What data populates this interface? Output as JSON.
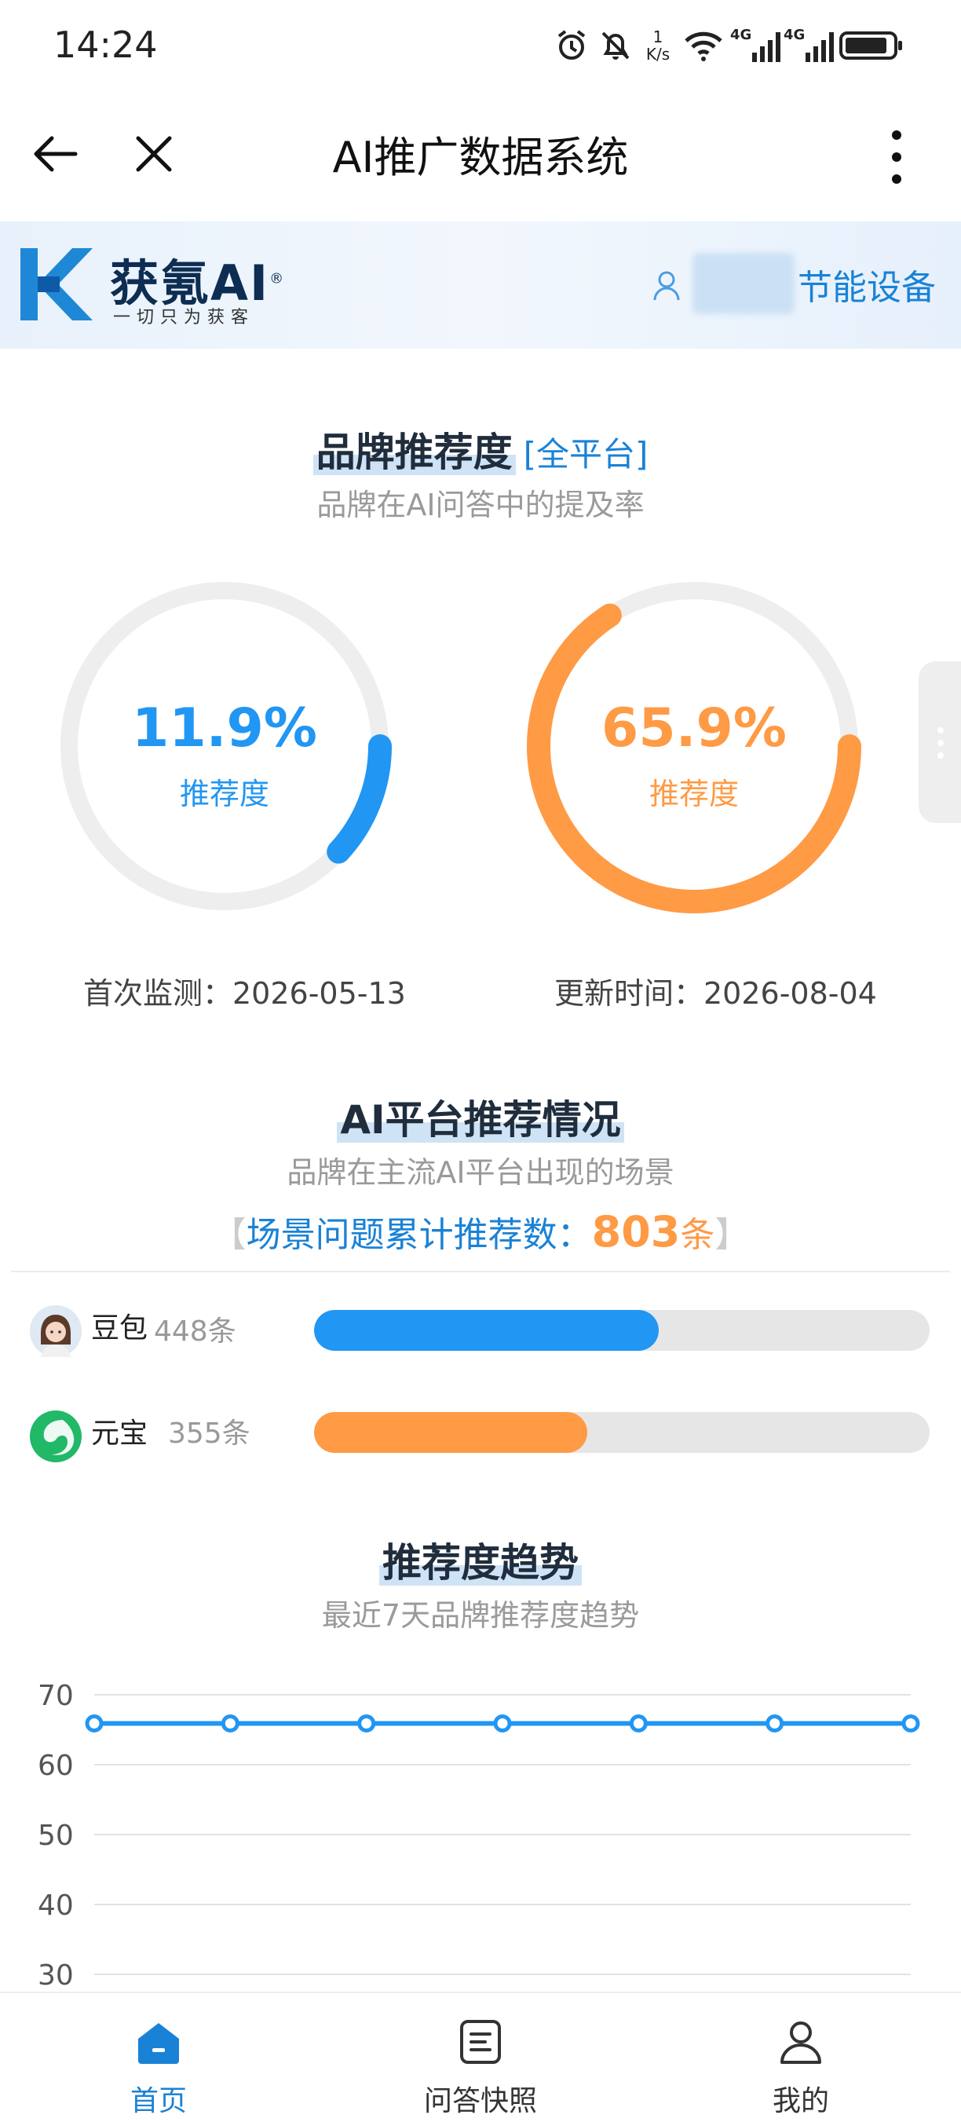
{
  "status_bar": {
    "time": "14:24",
    "net_speed_top": "1",
    "net_speed_unit": "K/s",
    "signal1": "4G",
    "signal2": "4G",
    "icons": [
      "alarm-icon",
      "mute-bell-icon",
      "wifi-icon",
      "signal-icon",
      "battery-icon"
    ]
  },
  "nav": {
    "title": "AI推广数据系统",
    "icons": [
      "back-arrow-icon",
      "close-icon",
      "more-vertical-icon"
    ]
  },
  "banner": {
    "logo_name": "获氪AI",
    "logo_reg": "®",
    "logo_slogan": "一切只为获客",
    "company_suffix": "节能设备",
    "user_icon": "user-icon"
  },
  "brand_section": {
    "title": "品牌推荐度",
    "tag": "[全平台]",
    "subtitle": "品牌在AI问答中的提及率",
    "gauges": [
      {
        "value": 11.9,
        "value_text": "11.9%",
        "label": "推荐度",
        "color": "#2196f3"
      },
      {
        "value": 65.9,
        "value_text": "65.9%",
        "label": "推荐度",
        "color": "#ff9a45"
      }
    ],
    "first_monitor": "首次监测：2026-05-13",
    "updated": "更新时间：2026-08-04"
  },
  "platform_section": {
    "title": "AI平台推荐情况",
    "subtitle": "品牌在主流AI平台出现的场景",
    "count_label": "场景问题累计推荐数：",
    "count_value": "803",
    "count_unit": "条",
    "bracket_left": "【",
    "bracket_right": "】",
    "platforms": [
      {
        "name": "豆包",
        "count_text": "448条",
        "count": 448,
        "color": "#2196f3",
        "icon": "doubao-avatar-icon"
      },
      {
        "name": "元宝",
        "count_text": "355条",
        "count": 355,
        "color": "#ff9a45",
        "icon": "yuanbao-logo-icon"
      }
    ]
  },
  "trend_section": {
    "title": "推荐度趋势",
    "subtitle": "最近7天品牌推荐度趋势"
  },
  "chart_data": {
    "type": "line",
    "title": "",
    "xlabel": "",
    "ylabel": "",
    "y_ticks": [
      "70",
      "60",
      "50",
      "40",
      "30"
    ],
    "ylim": [
      30,
      70
    ],
    "grid": true,
    "series": [
      {
        "color": "#2196f3",
        "values": [
          65.9,
          65.9,
          65.9,
          65.9,
          65.9,
          65.9,
          65.9
        ]
      }
    ]
  },
  "tab_bar": {
    "tabs": [
      {
        "label": "首页",
        "icon": "home-icon",
        "active": true
      },
      {
        "label": "问答快照",
        "icon": "document-icon",
        "active": false
      },
      {
        "label": "我的",
        "icon": "profile-icon",
        "active": false
      }
    ],
    "active_color": "#1a82d6",
    "inactive_color": "#333333"
  }
}
